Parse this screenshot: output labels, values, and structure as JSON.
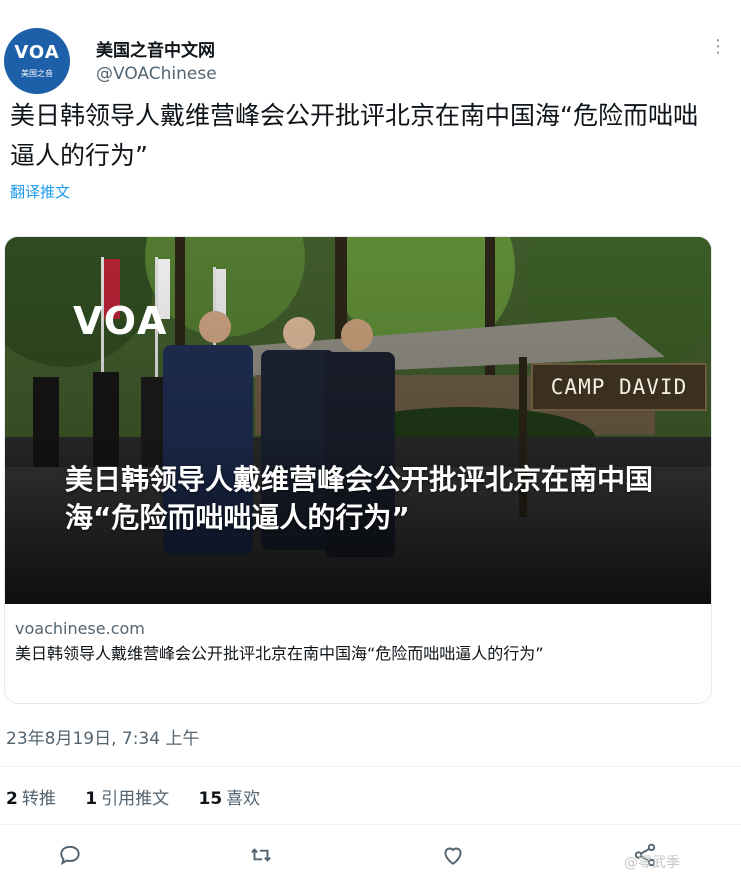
{
  "account": {
    "avatar_logo": "VOA",
    "avatar_sub": "美国之音",
    "display_name": "美国之音中文网",
    "handle": "@VOAChinese"
  },
  "tweet": {
    "text": "美日韩领导人戴维营峰会公开批评北京在南中国海“危险而咄咄逼人的行为”",
    "translate_label": "翻译推文",
    "timestamp": "23年8月19日, 7:34 上午"
  },
  "card": {
    "image_watermark": "VOA",
    "sign_text": "CAMP DAVID",
    "image_headline": "美日韩领导人戴维营峰会公开批评北京在南中国海“危险而咄咄逼人的行为”",
    "domain": "voachinese.com",
    "title": "美日韩领导人戴维营峰会公开批评北京在南中国海“危险而咄咄逼人的行为”"
  },
  "stats": {
    "retweets_count": "2",
    "retweets_label": "转推",
    "quotes_count": "1",
    "quotes_label": "引用推文",
    "likes_count": "15",
    "likes_label": "喜欢"
  },
  "actions": [
    "reply-icon",
    "retweet-icon",
    "like-icon",
    "share-icon"
  ],
  "watermark": "@零武季",
  "colors": {
    "link": "#1d9bf0",
    "muted": "#536471",
    "voa_blue": "#1d5fa8"
  }
}
